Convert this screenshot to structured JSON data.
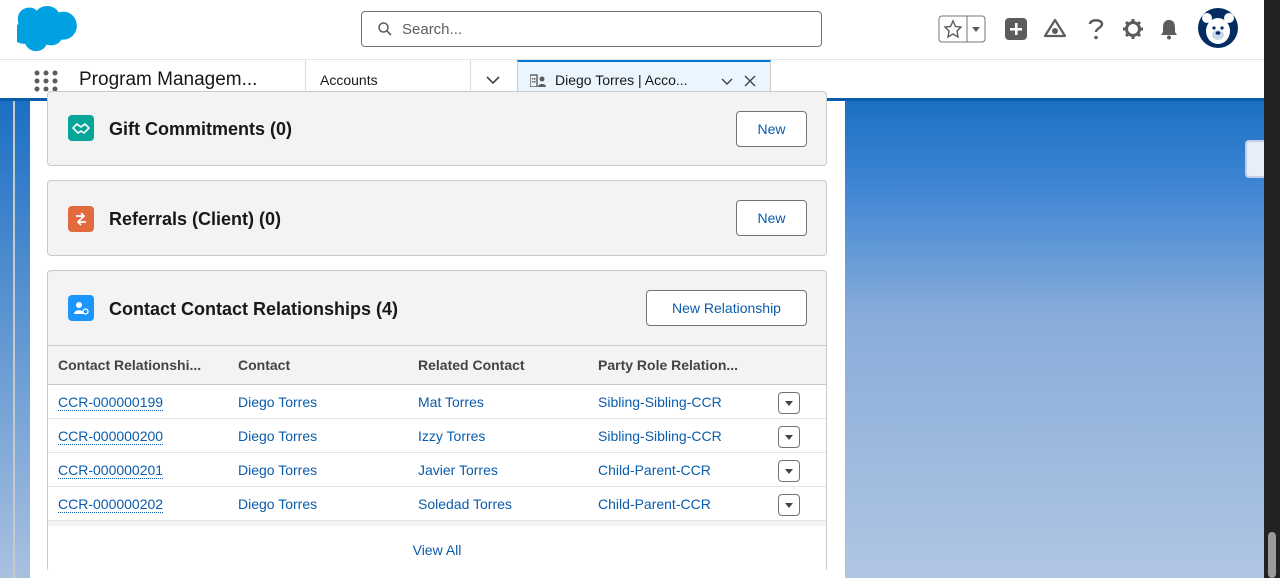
{
  "header": {
    "search_placeholder": "Search..."
  },
  "nav": {
    "app_name": "Program Managem...",
    "tab_accounts": "Accounts",
    "active_tab_label": "Diego Torres | Acco..."
  },
  "cards": {
    "gift": {
      "title": "Gift Commitments (0)",
      "button": "New",
      "icon_color": "#06a59a"
    },
    "referrals": {
      "title": "Referrals (Client) (0)",
      "button": "New",
      "icon_color": "#e3693e"
    },
    "relationships": {
      "title": "Contact Contact Relationships (4)",
      "button": "New Relationship",
      "icon_color": "#1b96ff",
      "columns": [
        "Contact Relationshi...",
        "Contact",
        "Related Contact",
        "Party Role Relation..."
      ],
      "rows": [
        {
          "id": "CCR-000000199",
          "contact": "Diego Torres",
          "related": "Mat Torres",
          "role": "Sibling-Sibling-CCR"
        },
        {
          "id": "CCR-000000200",
          "contact": "Diego Torres",
          "related": "Izzy Torres",
          "role": "Sibling-Sibling-CCR"
        },
        {
          "id": "CCR-000000201",
          "contact": "Diego Torres",
          "related": "Javier Torres",
          "role": "Child-Parent-CCR"
        },
        {
          "id": "CCR-000000202",
          "contact": "Diego Torres",
          "related": "Soledad Torres",
          "role": "Child-Parent-CCR"
        }
      ],
      "view_all": "View All"
    }
  },
  "colors": {
    "brand": "#0176d3",
    "link": "#0b5cab",
    "logo": "#00a1e0"
  }
}
